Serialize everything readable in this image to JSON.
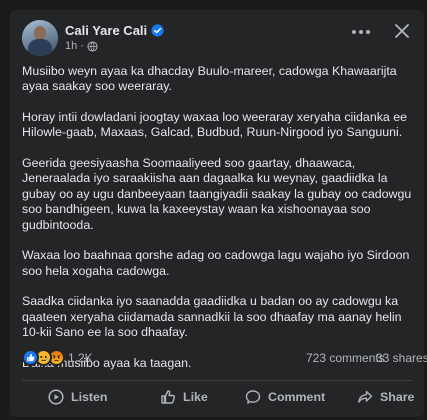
{
  "post": {
    "author": "Cali Yare Cali",
    "time": "1h",
    "paragraphs": [
      "Musiibo weyn ayaa ka dhacday Buulo-mareer, cadowga Khawaarijta ayaa saakay soo weeraray.",
      "Horay intii dowladani joogtay waxaa loo weeraray xeryaha ciidanka ee Hilowle-gaab, Maxaas, Galcad, Budbud, Ruun-Nirgood iyo Sanguuni.",
      "Geerida geesiyaasha Soomaaliyeed soo gaartay, dhaawaca, Jeneraalada iyo saraakiisha aan dagaalka ku weynay, gaadiidka la gubay oo ay ugu danbeeyaan taangiyadii saakay la gubay oo cadowgu soo bandhigeen, kuwa la kaxeeystay waan ka xishoonayaa soo gudbintooda.",
      "Waxaa loo baahnaa qorshe adag oo cadowga lagu wajaho iyo Sirdoon soo hela xogaha cadowga.",
      "Saadka ciidanka iyo saanadda gaadiidka u badan oo ay cadowgu ka qaateen xeryaha ciidamada sannadkii la soo dhaafay ma aanay helin 10-kii Sano ee la soo dhaafay.",
      "Dalka musiibo ayaa ka taagan."
    ]
  },
  "stats": {
    "reactions": "1.2K",
    "comments": "723 comments",
    "shares": "33 shares",
    "reaction_icons": [
      "like-icon",
      "sad-icon",
      "angry-icon"
    ]
  },
  "actions": {
    "listen": "Listen",
    "like": "Like",
    "comment": "Comment",
    "share": "Share"
  },
  "icons": {
    "verified": "verified-badge-icon",
    "audience": "globe-icon",
    "more": "more-options-icon",
    "close": "close-icon"
  },
  "colors": {
    "background": "#242526",
    "text": "#e4e6eb",
    "muted": "#b0b3b8",
    "accent": "#1877f2"
  }
}
